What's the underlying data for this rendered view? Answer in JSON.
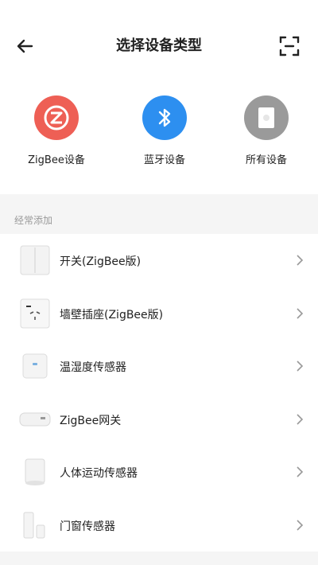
{
  "header": {
    "title": "选择设备类型"
  },
  "categories": [
    {
      "label": "ZigBee设备",
      "color": "#ee5f55"
    },
    {
      "label": "蓝牙设备",
      "color": "#2d8ff0"
    },
    {
      "label": "所有设备",
      "color": "#9a9a9a"
    }
  ],
  "section": {
    "title": "经常添加"
  },
  "devices": [
    {
      "name": "开关(ZigBee版)"
    },
    {
      "name": "墙壁插座(ZigBee版)"
    },
    {
      "name": "温湿度传感器"
    },
    {
      "name": "ZigBee网关"
    },
    {
      "name": "人体运动传感器"
    },
    {
      "name": "门窗传感器"
    }
  ]
}
